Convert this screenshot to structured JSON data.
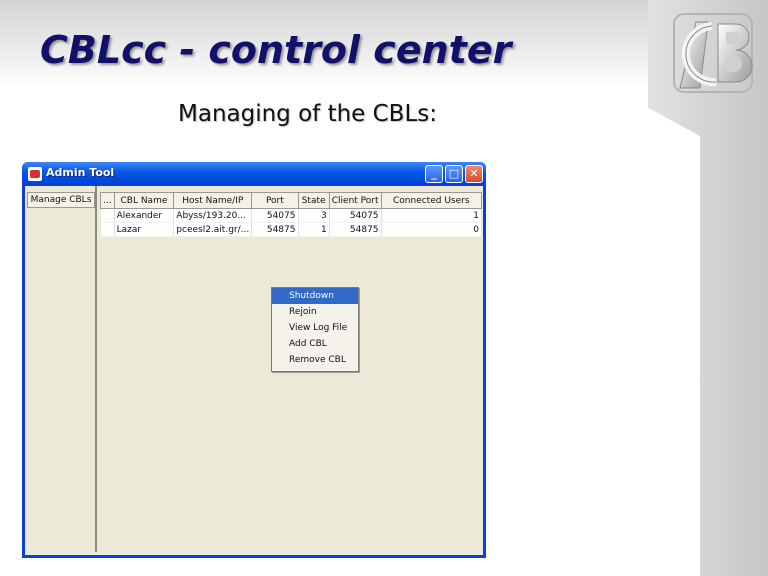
{
  "slide": {
    "title": "CBLcc - control center",
    "subtitle": "Managing of the CBLs:",
    "logo_text": "ACB"
  },
  "window": {
    "title": "Admin Tool",
    "controls": {
      "minimize": "_",
      "maximize": "□",
      "close": "✕"
    },
    "left_tab": "Manage CBLs",
    "table": {
      "columns": [
        "...",
        "CBL Name",
        "Host Name/IP",
        "Port",
        "State",
        "Client Port",
        "Connected Users"
      ],
      "rows": [
        [
          "",
          "Alexander",
          "Abyss/193.20...",
          "54075",
          "3",
          "54075",
          "1"
        ],
        [
          "",
          "Lazar",
          "pceesl2.ait.gr/...",
          "54875",
          "1",
          "54875",
          "0"
        ]
      ]
    }
  },
  "context_menu": {
    "items": [
      "Shutdown",
      "Rejoin",
      "View Log File",
      "Add CBL",
      "Remove CBL"
    ],
    "highlighted": "Shutdown"
  },
  "colors": {
    "title_blue": "#11116b",
    "titlebar_blue": "#0a3fd8",
    "menu_highlight": "#3169c6",
    "window_bg": "#ece9d8"
  }
}
